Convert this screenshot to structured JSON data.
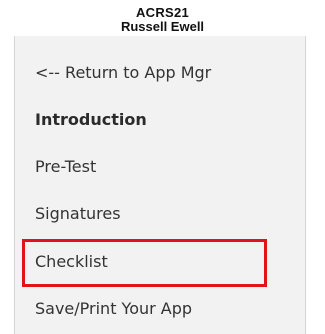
{
  "header": {
    "app_code": "ACRS21",
    "user_name": "Russell Ewell"
  },
  "nav": {
    "items": [
      {
        "label": "<-- Return to App Mgr",
        "bold": false
      },
      {
        "label": "Introduction",
        "bold": true
      },
      {
        "label": "Pre-Test",
        "bold": false
      },
      {
        "label": "Signatures",
        "bold": false
      },
      {
        "label": "Checklist",
        "bold": false,
        "highlighted": true
      },
      {
        "label": "Save/Print Your App",
        "bold": false
      }
    ]
  },
  "colors": {
    "highlight_border": "#e3131b",
    "nav_background": "#f2f2f2",
    "text": "#333333"
  }
}
